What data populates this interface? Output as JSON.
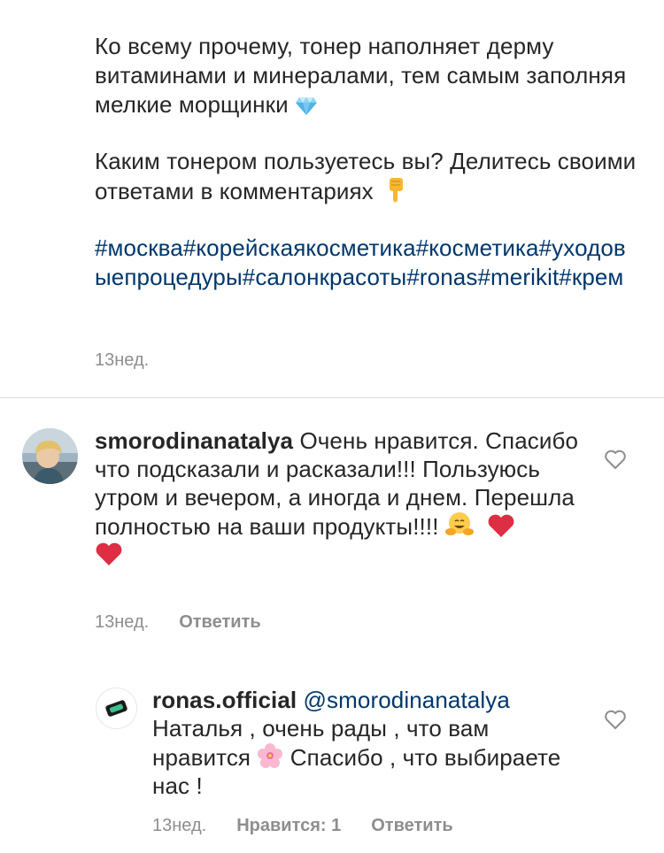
{
  "post": {
    "caption_p1": "Ко всему прочему, тонер наполняет дерму витаминами и минералами, тем самым заполняя мелкие морщинки",
    "caption_p1_emoji": "gem-icon",
    "caption_p2": "Каким тонером пользуетесь вы? Делитесь своими ответами в комментариях",
    "caption_p2_emoji": "pointing-down-icon",
    "hashtags": [
      "#москва",
      "#корейскаякосметика",
      "#косметика",
      "#уходовыепроцедуры",
      "#салонкрасоты",
      "#ronas",
      "#merikit",
      "#крем"
    ],
    "time": "13нед."
  },
  "comments": [
    {
      "username": "smorodinanatalya",
      "text": "Очень нравится. Спасибо что подсказали и расказали!!! Пользуюсь утром и вечером, а иногда и днем. Перешла полностью на ваши продукты!!!!",
      "emojis": [
        "hugging-face-icon",
        "red-heart-icon",
        "red-heart-icon"
      ],
      "time": "13нед.",
      "reply_label": "Ответить"
    },
    {
      "username": "ronas.official",
      "mention": "@smorodinanatalya",
      "text_before_emoji": "Наталья , очень рады , что вам нравится",
      "emoji": "cherry-blossom-icon",
      "text_after_emoji": "Спасибо , что выбираете нас !",
      "time": "13нед.",
      "likes_label": "Нравится: 1",
      "reply_label": "Ответить"
    }
  ],
  "colors": {
    "text": "#262626",
    "secondary": "#8e8e8e",
    "link": "#00376b",
    "divider": "#dbdbdb"
  }
}
